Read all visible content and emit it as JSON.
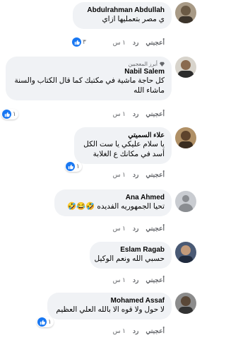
{
  "comments": [
    {
      "author": "Abdulrahman Abdullah",
      "text_lines": [
        "ي مصر بتعمليها ازاي"
      ],
      "time": "١ س",
      "reply": "رد",
      "like": "أعجبني",
      "reaction_count": "٣",
      "avatar": "photo-avatar"
    },
    {
      "badge": "أبرز المعجبين",
      "badge_icon": "diamond-icon",
      "author": "Nabil Salem",
      "text_lines": [
        "كل حاجة ماشية في مكتبك كما قال الكتاب والسنة",
        "ماشاء الله"
      ],
      "time": "١ س",
      "reply": "رد",
      "like": "أعجبني",
      "reaction_count": "١",
      "avatar": "photo-avatar"
    },
    {
      "author": "علاء السميتي",
      "text_lines": [
        "يا سلام عليكي يا ست الكل",
        "أسد في مكانك ع الغلابة"
      ],
      "time": "١ س",
      "reply": "رد",
      "like": "أعجبني",
      "reaction_count": "١",
      "avatar": "photo-avatar"
    },
    {
      "author": "Ana Ahmed",
      "text_lines": [
        "تحيا الجمهوريه الفديده 🤣😂🤣"
      ],
      "time": "١ س",
      "reply": "رد",
      "like": "أعجبني",
      "reaction_count": "",
      "avatar": "default-avatar"
    },
    {
      "author": "Eslam Ragab",
      "text_lines": [
        "حسبي الله ونعم الوكيل"
      ],
      "time": "١ س",
      "reply": "رد",
      "like": "أعجبني",
      "reaction_count": "",
      "avatar": "photo-avatar"
    },
    {
      "author": "Mohamed Assaf",
      "text_lines": [
        "لا حول ولا قوه الا بالله العلي العظيم"
      ],
      "time": "١ س",
      "reply": "رد",
      "like": "أعجبني",
      "reaction_count": "١",
      "avatar": "photo-avatar"
    }
  ],
  "colors": {
    "bubble": "#f0f2f5",
    "like_blue": "#1877f2",
    "meta_gray": "#65676b"
  }
}
